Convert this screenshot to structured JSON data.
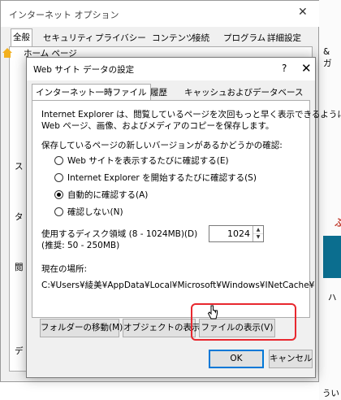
{
  "background": {
    "title": "インターネット オプション",
    "tabs": [
      "全般",
      "セキュリティ",
      "プライバシー",
      "コンテンツ",
      "接続",
      "プログラム",
      "詳細設定"
    ],
    "home_page_label": "ホーム ページ",
    "fragments": {
      "right_top": "& ガ",
      "left_s": "ス",
      "left_ta": "タ",
      "left_kan": "閲",
      "left_de": "デ",
      "right_hu": "ふ",
      "right_ha": "ハ",
      "right_bottom": "うい"
    }
  },
  "dialog": {
    "title": "Web サイト データの設定",
    "help": "?",
    "tabs": [
      "インターネット一時ファイル",
      "履歴",
      "キャッシュおよびデータベース"
    ],
    "description_line1": "Internet Explorer は、閲覧しているページを次回もっと早く表示できるように",
    "description_line2": "Web ページ、画像、およびメディアのコピーを保存します。",
    "check_prompt": "保存しているページの新しいバージョンがあるかどうかの確認:",
    "radios": [
      {
        "label": "Web サイトを表示するたびに確認する(E)",
        "checked": false
      },
      {
        "label": "Internet Explorer を開始するたびに確認する(S)",
        "checked": false
      },
      {
        "label": "自動的に確認する(A)",
        "checked": true
      },
      {
        "label": "確認しない(N)",
        "checked": false
      }
    ],
    "disk_space_label": "使用するディスク領域 (8 - 1024MB)(D)",
    "disk_space_recommended": "(推奨: 50 - 250MB)",
    "disk_space_value": "1024",
    "current_location_label": "現在の場所:",
    "current_location_path": "C:¥Users¥綾美¥AppData¥Local¥Microsoft¥Windows¥INetCache¥",
    "buttons": {
      "move_folder": "フォルダーの移動(M)...",
      "view_objects": "オブジェクトの表示(O)",
      "view_files": "ファイルの表示(V)",
      "ok": "OK",
      "cancel": "キャンセル"
    }
  },
  "colors": {
    "highlight": "#e8282f",
    "primary_border": "#0078d7"
  }
}
